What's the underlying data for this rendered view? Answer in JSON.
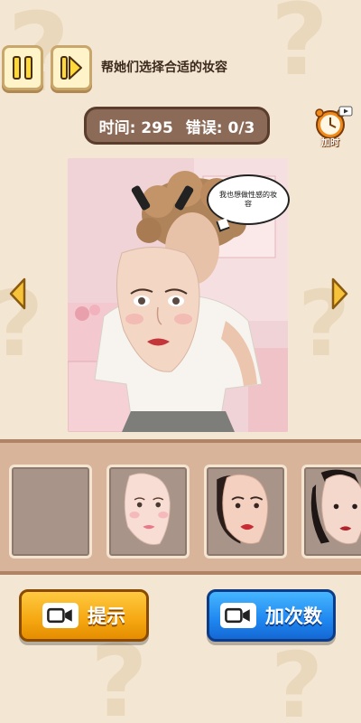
{
  "header": {
    "title": "帮她们选择合适的妆容"
  },
  "status": {
    "time_label": "时间: 295",
    "error_label": "错误: 0/3",
    "add_time_label": "加时"
  },
  "scene": {
    "speech_text": "我也想做性感的妆容"
  },
  "buttons": {
    "hint_label": "提示",
    "add_count_label": "加次数"
  },
  "colors": {
    "hint_button": "#f5a711",
    "add_button": "#1f87f0",
    "timer_bg": "#8b6a58"
  },
  "icons": {
    "pause": "pause-icon",
    "skip": "skip-icon",
    "alarm": "alarm-clock-icon",
    "video": "video-icon",
    "left": "arrow-left-icon",
    "right": "arrow-right-icon"
  }
}
